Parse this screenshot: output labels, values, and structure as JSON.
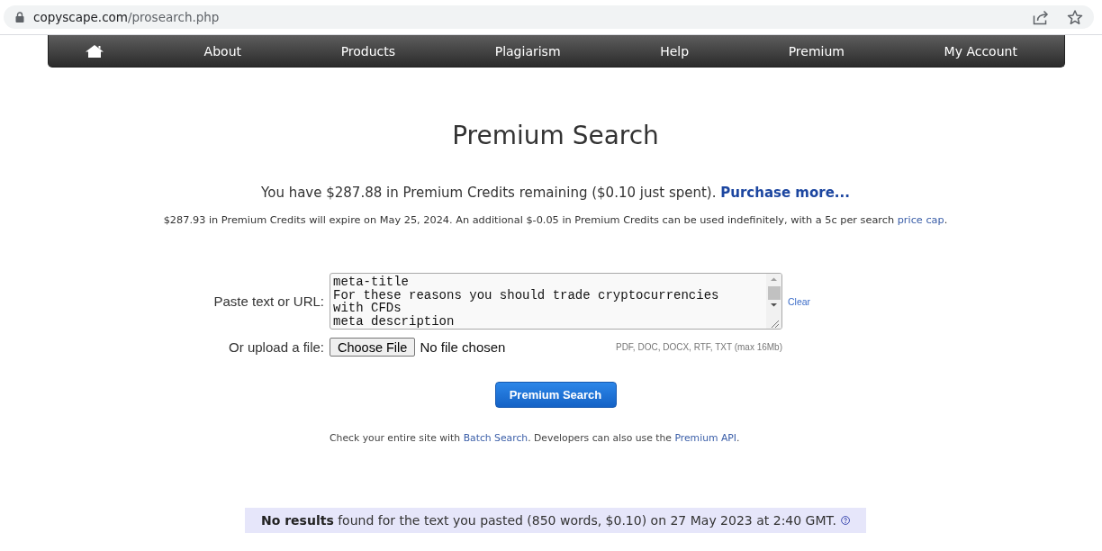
{
  "browser": {
    "url_host": "copyscape.com",
    "url_path": "/prosearch.php"
  },
  "nav": {
    "items": [
      {
        "kind": "home"
      },
      {
        "kind": "link",
        "label": "About"
      },
      {
        "kind": "link",
        "label": "Products"
      },
      {
        "kind": "link",
        "label": "Plagiarism"
      },
      {
        "kind": "link",
        "label": "Help"
      },
      {
        "kind": "link",
        "label": "Premium"
      },
      {
        "kind": "link",
        "label": "My Account"
      }
    ]
  },
  "title": "Premium Search",
  "credits": {
    "text": "You have $287.88 in Premium Credits remaining ($0.10 just spent).",
    "link": "Purchase more..."
  },
  "expiry": {
    "text": "$287.93 in Premium Credits will expire on May 25, 2024. An additional $-0.05 in Premium Credits can be used indefinitely, with a 5c per search",
    "link": "price cap",
    "end": "."
  },
  "form": {
    "text_label": "Paste text or URL:",
    "text_value": "meta-title\nFor these reasons you should trade cryptocurrencies with CFDs\nmeta description",
    "clear_link": "Clear",
    "file_label": "Or upload a file:",
    "file_button": "Choose File",
    "file_status": "No file chosen",
    "file_hint": "PDF, DOC, DOCX, RTF, TXT (max 16Mb)",
    "submit": "Premium Search"
  },
  "note": {
    "segments": [
      {
        "kind": "text",
        "text": "Check your entire site with "
      },
      {
        "kind": "link",
        "text": "Batch Search"
      },
      {
        "kind": "text",
        "text": ". Developers can also use the "
      },
      {
        "kind": "link",
        "text": "Premium API"
      },
      {
        "kind": "text",
        "text": "."
      }
    ]
  },
  "result": {
    "message": "**No results** found for the text you pasted (850 words, $0.10) on 27 May 2023 at 2:40 GMT."
  }
}
